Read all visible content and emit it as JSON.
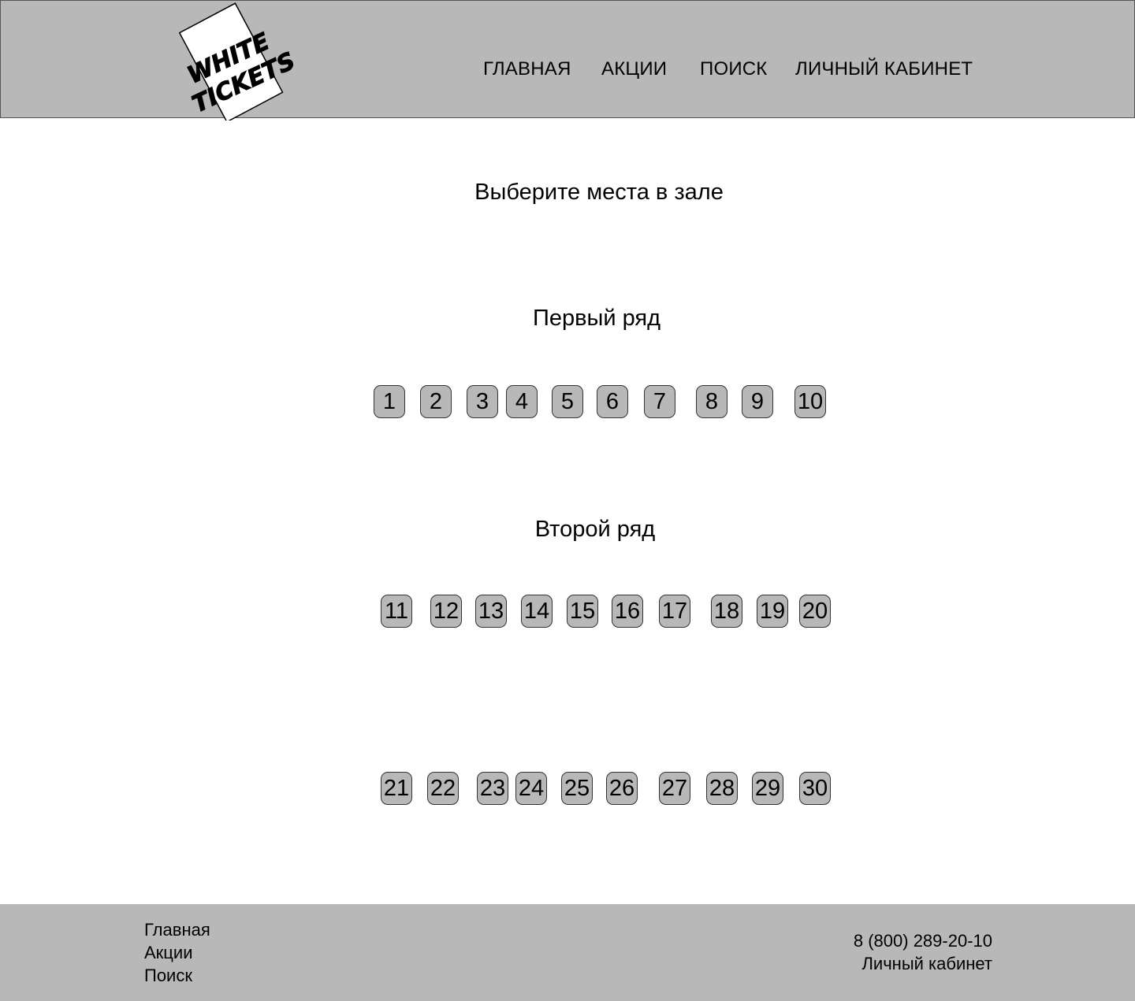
{
  "header": {
    "logo": {
      "line1": "WHITE",
      "line2": "TICKETS"
    },
    "nav": [
      {
        "label": "ГЛАВНАЯ"
      },
      {
        "label": "АКЦИИ"
      },
      {
        "label": "ПОИСК"
      },
      {
        "label": "ЛИЧНЫЙ КАБИНЕТ"
      }
    ]
  },
  "main": {
    "title": "Выберите места в зале",
    "rows": [
      {
        "title": "Первый ряд",
        "seats": [
          "1",
          "2",
          "3",
          "4",
          "5",
          "6",
          "7",
          "8",
          "9",
          "10"
        ]
      },
      {
        "title": "Второй ряд",
        "seats": [
          "11",
          "12",
          "13",
          "14",
          "15",
          "16",
          "17",
          "18",
          "19",
          "20"
        ]
      },
      {
        "title": "",
        "seats": [
          "21",
          "22",
          "23",
          "24",
          "25",
          "26",
          "27",
          "28",
          "29",
          "30"
        ]
      }
    ]
  },
  "footer": {
    "links": [
      {
        "label": "Главная"
      },
      {
        "label": "Акции"
      },
      {
        "label": "Поиск"
      }
    ],
    "phone": "8 (800) 289-20-10",
    "account_link": "Личный кабинет"
  },
  "colors": {
    "header_bg": "#b8b8b8",
    "footer_bg": "#b8b8b8",
    "seat_bg": "#b8b8b8"
  }
}
